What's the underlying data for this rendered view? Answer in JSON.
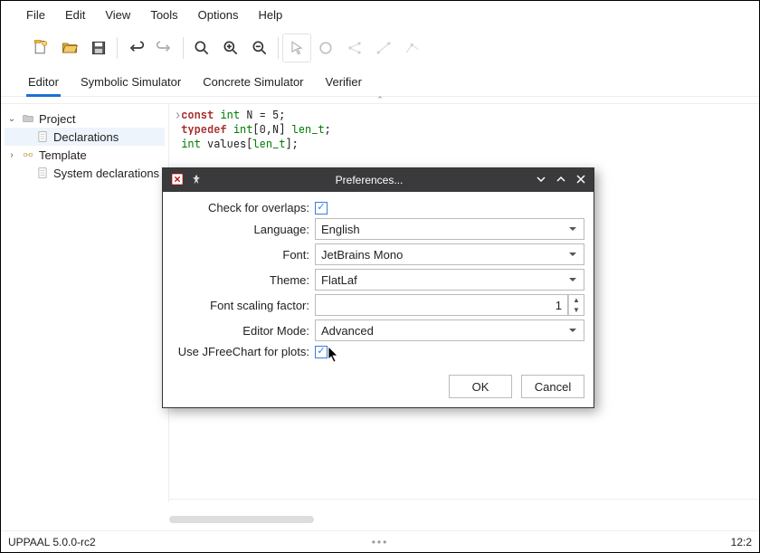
{
  "menu": {
    "file": "File",
    "edit": "Edit",
    "view": "View",
    "tools": "Tools",
    "options": "Options",
    "help": "Help"
  },
  "tabs": {
    "editor": "Editor",
    "symbolic": "Symbolic Simulator",
    "concrete": "Concrete Simulator",
    "verifier": "Verifier"
  },
  "tree": {
    "project": "Project",
    "declarations": "Declarations",
    "template": "Template",
    "sysdecl": "System declarations"
  },
  "code": {
    "l1a": "const",
    "l1b": "int",
    "l1c": " N = 5;",
    "l2a": "typedef",
    "l2b": "int",
    "l2c": "[0,N] ",
    "l2d": "len_t",
    "l2e": ";",
    "l3a": "int",
    "l3b": " values[",
    "l3c": "len_t",
    "l3d": "];"
  },
  "status": {
    "version": "UPPAAL 5.0.0-rc2",
    "pos": "12:2"
  },
  "dialog": {
    "title": "Preferences...",
    "overlaps_label": "Check for overlaps:",
    "language_label": "Language:",
    "language_value": "English",
    "font_label": "Font:",
    "font_value": "JetBrains Mono",
    "theme_label": "Theme:",
    "theme_value": "FlatLaf",
    "scaling_label": "Font scaling factor:",
    "scaling_value": "1",
    "mode_label": "Editor Mode:",
    "mode_value": "Advanced",
    "jfreechart_label": "Use JFreeChart for plots:",
    "ok": "OK",
    "cancel": "Cancel"
  }
}
